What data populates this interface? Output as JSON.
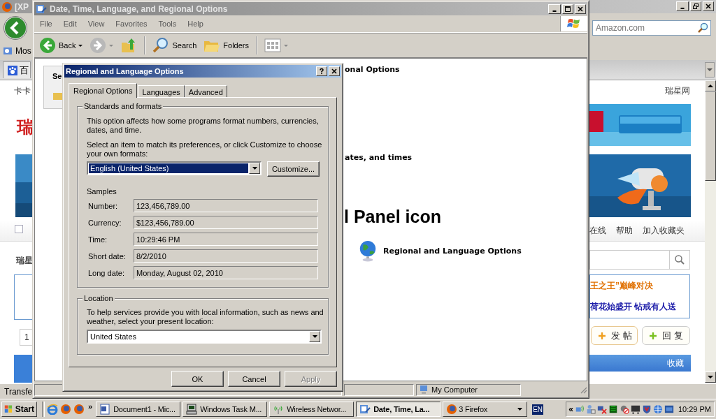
{
  "browser": {
    "title": "[XP",
    "search": {
      "placeholder": "Amazon.com"
    },
    "bookmark": "Mos",
    "tab": "百",
    "site": {
      "checked": false,
      "top_left": "卡卡",
      "top_right": "瑞星网",
      "logo": "瑞",
      "nav": [
        "在线",
        "帮助",
        "加入收藏夹"
      ],
      "section": "瑞星",
      "headline": "王之王”巅峰对决",
      "promo": "荷花始盛开 钻戒有人送",
      "page": "1",
      "post_button": "发 帖",
      "reply_button": "回 复",
      "bar_label": "收藏"
    },
    "status": "Transfe"
  },
  "explorer": {
    "title": "Date, Time, Language, and Regional Options",
    "menu": [
      "File",
      "Edit",
      "View",
      "Favorites",
      "Tools",
      "Help"
    ],
    "toolbar": [
      {
        "kind": "back",
        "label": "Back"
      },
      {
        "kind": "forward"
      },
      {
        "kind": "up"
      },
      {
        "kind": "search",
        "label": "Search"
      },
      {
        "kind": "folders",
        "label": "Folders"
      },
      {
        "kind": "views"
      }
    ],
    "side_heading": "Se",
    "lines": [
      {
        "kind": "heading",
        "text": "onal Options"
      },
      {
        "kind": "heading",
        "text": "ates, and times"
      },
      {
        "kind": "title",
        "text": "l Panel icon"
      },
      {
        "kind": "link",
        "text": "Regional and Language Options"
      }
    ],
    "status": "My Computer"
  },
  "dialog": {
    "title": "Regional and Language Options",
    "tabs": [
      {
        "label": "Regional Options",
        "selected": true
      },
      {
        "label": "Languages",
        "selected": false
      },
      {
        "label": "Advanced",
        "selected": false
      }
    ],
    "standards": {
      "legend": "Standards and formats",
      "intro": "This option affects how some programs format numbers, currencies, dates, and time.",
      "instruction": "Select an item to match its preferences, or click Customize to choose your own formats:",
      "format": "English (United States)",
      "customize": "Customize...",
      "samples_label": "Samples",
      "samples": [
        {
          "label": "Number:",
          "value": "123,456,789.00"
        },
        {
          "label": "Currency:",
          "value": "$123,456,789.00"
        },
        {
          "label": "Time:",
          "value": "10:29:46 PM"
        },
        {
          "label": "Short date:",
          "value": "8/2/2010"
        },
        {
          "label": "Long date:",
          "value": "Monday, August 02, 2010"
        }
      ]
    },
    "location": {
      "legend": "Location",
      "text": "To help services provide you with local information, such as news and weather, select your present location:",
      "value": "United States"
    },
    "buttons": [
      {
        "label": "OK",
        "disabled": false
      },
      {
        "label": "Cancel",
        "disabled": false
      },
      {
        "label": "Apply",
        "disabled": true
      }
    ]
  },
  "taskbar": {
    "start": "Start",
    "quick_launch": [
      {
        "kind": "ie"
      },
      {
        "kind": "firefox"
      },
      {
        "kind": "firefox"
      }
    ],
    "overflow": "»",
    "tasks": [
      {
        "kind": "word",
        "label": "Document1 - Mic...",
        "selected": false,
        "grouped": false
      },
      {
        "kind": "taskmgr",
        "label": "Windows Task M...",
        "selected": false,
        "grouped": false
      },
      {
        "kind": "wireless",
        "label": "Wireless Networ...",
        "selected": false,
        "grouped": false
      },
      {
        "kind": "explorer",
        "label": "Date, Time, La...",
        "selected": true,
        "grouped": false
      },
      {
        "kind": "firefox",
        "label": "3 Firefox",
        "selected": false,
        "grouped": true
      }
    ],
    "language": "EN",
    "tray_expand": "«",
    "clock": "10:29 PM"
  }
}
